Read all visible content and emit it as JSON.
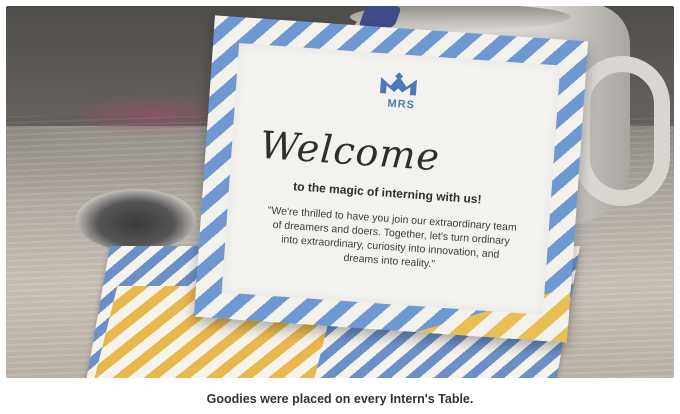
{
  "card": {
    "logo_text": "MRS",
    "welcome": "Welcome",
    "tagline": "to the magic of interning with us!",
    "quote": "\"We're thrilled to have you join our extraordinary team of dreamers and doers. Together, let's turn ordinary into extraordinary, curiosity into innovation, and dreams into reality.\""
  },
  "caption": "Goodies were placed on every Intern's Table.",
  "colors": {
    "stripe_blue": "#6d98d2",
    "stripe_yellow": "#e9bf55",
    "logo_blue": "#4a78b8"
  }
}
